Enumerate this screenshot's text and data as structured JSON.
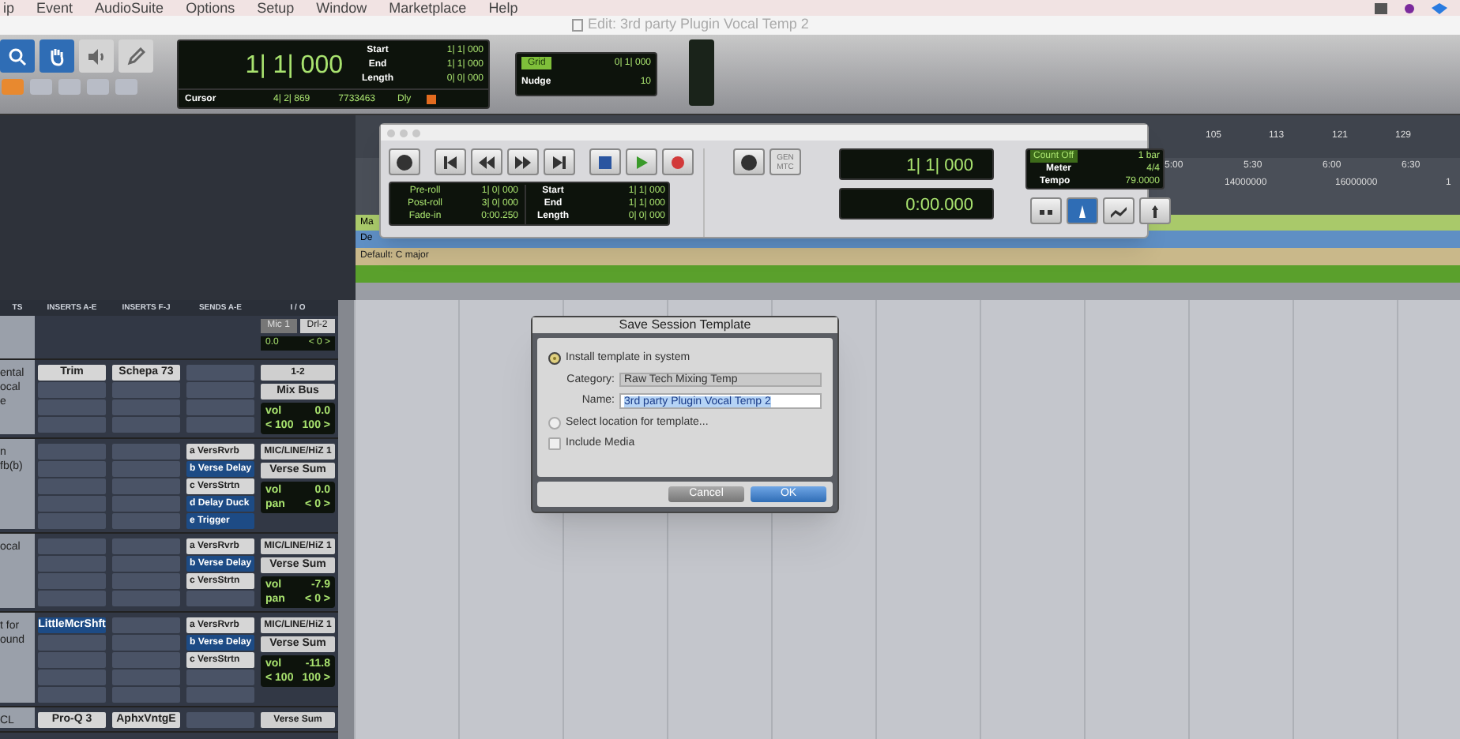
{
  "menu": [
    "ip",
    "Event",
    "AudioSuite",
    "Options",
    "Setup",
    "Window",
    "Marketplace",
    "Help"
  ],
  "window": {
    "title": "Edit: 3rd party Plugin Vocal Temp 2"
  },
  "tools": [
    {
      "kind": "zoom",
      "selected": true
    },
    {
      "kind": "hand",
      "selected": true
    },
    {
      "kind": "speaker",
      "selected": false
    },
    {
      "kind": "pencil",
      "selected": false
    }
  ],
  "modes": [
    {
      "selected": true
    },
    {
      "selected": false
    },
    {
      "selected": false
    },
    {
      "selected": false
    },
    {
      "selected": false
    }
  ],
  "counter": {
    "main": "1| 1| 000",
    "rows": [
      {
        "label": "Start",
        "value": "1| 1| 000"
      },
      {
        "label": "End",
        "value": "1| 1| 000"
      },
      {
        "label": "Length",
        "value": "0| 0| 000"
      }
    ],
    "cursor_label": "Cursor",
    "cursor": "4| 2| 869",
    "sample": "7733463",
    "delay": "Dly"
  },
  "grid": {
    "label": "Grid",
    "value": "0| 1| 000",
    "nudge_label": "Nudge",
    "nudge": "10"
  },
  "transport": {
    "gen": "GEN MTC",
    "rows": [
      {
        "label": "Pre-roll",
        "value": "1| 0| 000"
      },
      {
        "label": "Post-roll",
        "value": "3| 0| 000"
      },
      {
        "label": "Fade-in",
        "value": "0:00.250"
      }
    ],
    "range": [
      {
        "label": "Start",
        "value": "1| 1| 000"
      },
      {
        "label": "End",
        "value": "1| 1| 000"
      },
      {
        "label": "Length",
        "value": "0| 0| 000"
      }
    ],
    "main": "1| 1| 000",
    "sub": "0:00.000",
    "count_off": "Count Off",
    "bars": "1 bar",
    "meter_label": "Meter",
    "meter": "4/4",
    "tempo_label": "Tempo",
    "tempo": "79.0000"
  },
  "timeline": {
    "bars": [
      "105",
      "113",
      "121",
      "129"
    ],
    "times": [
      "5:00",
      "5:30",
      "6:00",
      "6:30"
    ],
    "samples": [
      "14000000",
      "16000000",
      "1"
    ],
    "markers": [
      "Ma",
      "De"
    ],
    "key": "Default: C major"
  },
  "mix": {
    "columns": [
      "TS",
      "INSERTS A-E",
      "INSERTS F-J",
      "SENDS A-E",
      "I / O"
    ],
    "master": {
      "input": "Mic 1",
      "output": "Drl-2",
      "vol": "0.0",
      "pan": "< 0 >"
    },
    "tracks": [
      {
        "name": [
          "ental",
          "ocal",
          "e"
        ],
        "inserts_a": [
          {
            "kind": "plugin",
            "label": "Trim"
          },
          {
            "kind": "empty"
          },
          {
            "kind": "empty"
          },
          {
            "kind": "empty"
          }
        ],
        "inserts_f": [
          {
            "kind": "plugin",
            "label": "Schepa 73"
          },
          {
            "kind": "empty"
          },
          {
            "kind": "empty"
          },
          {
            "kind": "empty"
          }
        ],
        "sends": [
          {
            "kind": "empty"
          },
          {
            "kind": "empty"
          },
          {
            "kind": "empty"
          },
          {
            "kind": "empty"
          }
        ],
        "input": "1-2",
        "output": "Mix Bus",
        "vol_label": "vol",
        "vol": "0.0",
        "pan": [
          "< 100",
          "100 >"
        ]
      },
      {
        "name": [
          "n",
          "fb(b)"
        ],
        "inserts_a": [
          {
            "kind": "empty"
          },
          {
            "kind": "empty"
          },
          {
            "kind": "empty"
          },
          {
            "kind": "empty"
          },
          {
            "kind": "empty"
          }
        ],
        "inserts_f": [
          {
            "kind": "empty"
          },
          {
            "kind": "empty"
          },
          {
            "kind": "empty"
          },
          {
            "kind": "empty"
          },
          {
            "kind": "empty"
          }
        ],
        "sends": [
          {
            "kind": "send",
            "letter": "a",
            "label": "VersRvrb",
            "highlighted": false
          },
          {
            "kind": "send",
            "letter": "b",
            "label": "Verse Delay",
            "highlighted": true
          },
          {
            "kind": "send",
            "letter": "c",
            "label": "VersStrtn",
            "highlighted": false
          },
          {
            "kind": "send",
            "letter": "d",
            "label": "Delay Duck",
            "highlighted": true
          },
          {
            "kind": "send",
            "letter": "e",
            "label": "Trigger",
            "highlighted": true
          }
        ],
        "input": "MIC/LINE/HiZ 1",
        "output": "Verse Sum",
        "vol_label": "vol",
        "vol": "0.0",
        "pan_label": "pan",
        "pan": [
          "< 0 >"
        ]
      },
      {
        "name": [
          "ocal"
        ],
        "inserts_a": [
          {
            "kind": "empty"
          },
          {
            "kind": "empty"
          },
          {
            "kind": "empty"
          },
          {
            "kind": "empty"
          }
        ],
        "inserts_f": [
          {
            "kind": "empty"
          },
          {
            "kind": "empty"
          },
          {
            "kind": "empty"
          },
          {
            "kind": "empty"
          }
        ],
        "sends": [
          {
            "kind": "send",
            "letter": "a",
            "label": "VersRvrb",
            "highlighted": false
          },
          {
            "kind": "send",
            "letter": "b",
            "label": "Verse Delay",
            "highlighted": true
          },
          {
            "kind": "send",
            "letter": "c",
            "label": "VersStrtn",
            "highlighted": false
          },
          {
            "kind": "empty"
          }
        ],
        "input": "MIC/LINE/HiZ 1",
        "output": "Verse Sum",
        "vol_label": "vol",
        "vol": "-7.9",
        "pan_label": "pan",
        "pan": [
          "< 0 >"
        ]
      },
      {
        "name": [
          "t for",
          "ound"
        ],
        "inserts_a": [
          {
            "kind": "plugin",
            "label": "LittleMcrShft",
            "highlighted": true
          },
          {
            "kind": "empty"
          },
          {
            "kind": "empty"
          },
          {
            "kind": "empty"
          },
          {
            "kind": "empty"
          }
        ],
        "inserts_f": [
          {
            "kind": "empty"
          },
          {
            "kind": "empty"
          },
          {
            "kind": "empty"
          },
          {
            "kind": "empty"
          },
          {
            "kind": "empty"
          }
        ],
        "sends": [
          {
            "kind": "send",
            "letter": "a",
            "label": "VersRvrb",
            "highlighted": false
          },
          {
            "kind": "send",
            "letter": "b",
            "label": "Verse Delay",
            "highlighted": true
          },
          {
            "kind": "send",
            "letter": "c",
            "label": "VersStrtn",
            "highlighted": false
          },
          {
            "kind": "empty"
          },
          {
            "kind": "empty"
          }
        ],
        "input": "MIC/LINE/HiZ 1",
        "output": "Verse Sum",
        "vol_label": "vol",
        "vol": "-11.8",
        "pan": [
          "< 100",
          "100 >"
        ]
      },
      {
        "name": [
          "CL"
        ],
        "inserts_a": [
          {
            "kind": "plugin",
            "label": "Pro-Q 3"
          }
        ],
        "inserts_f": [
          {
            "kind": "plugin",
            "label": "AphxVntgE"
          }
        ],
        "sends": [
          {
            "kind": "empty"
          }
        ],
        "input": "Verse Sum"
      }
    ]
  },
  "dialog": {
    "title": "Save Session Template",
    "options": [
      {
        "label": "Install template in system",
        "selected": true
      },
      {
        "label": "Select location for template...",
        "selected": false
      }
    ],
    "category_label": "Category:",
    "category": "Raw Tech Mixing Temp",
    "name_label": "Name:",
    "name": "3rd party Plugin Vocal Temp 2",
    "include_media": {
      "label": "Include Media",
      "checked": false
    },
    "cancel": "Cancel",
    "ok": "OK"
  }
}
